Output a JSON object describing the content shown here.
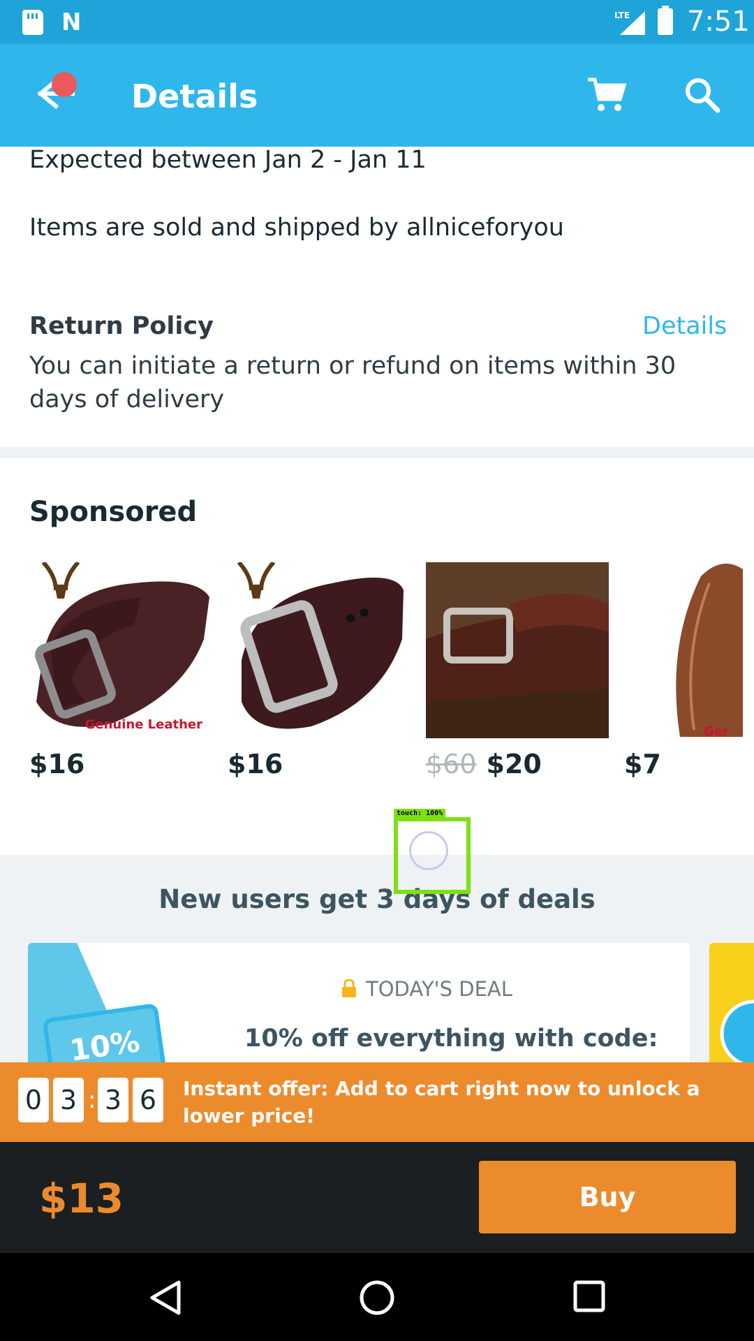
{
  "status_bar": {
    "time": "7:51",
    "network": "LTE"
  },
  "app_bar": {
    "title": "Details",
    "icons": [
      "back-arrow-icon",
      "cart-icon",
      "search-icon"
    ]
  },
  "shipping": {
    "expected": "Expected between Jan 2 - Jan 11",
    "sold_by": "Items are sold and shipped by allniceforyou"
  },
  "return_policy": {
    "title": "Return Policy",
    "details_link": "Details",
    "text": "You can initiate a return or refund on items within 30 days of delivery"
  },
  "sponsored": {
    "title": "Sponsored",
    "items": [
      {
        "price": "$16",
        "original_price": "",
        "image_text": "Genuine Leather"
      },
      {
        "price": "$16",
        "original_price": ""
      },
      {
        "price": "$20",
        "original_price": "$60"
      },
      {
        "price": "$7",
        "original_price": "",
        "image_text": "Ger"
      }
    ]
  },
  "touch_indicator": {
    "label": "touch: 100%"
  },
  "deals": {
    "title": "New users get 3 days of deals",
    "card": {
      "label": "TODAY'S DEAL",
      "headline": "10% off everything with code:",
      "ticket_text": "10%"
    }
  },
  "offer": {
    "countdown": [
      "0",
      "3",
      "3",
      "6"
    ],
    "separator": ":",
    "text": "Instant offer: Add to cart right now to unlock a lower price!"
  },
  "buy_bar": {
    "price": "$13",
    "button_label": "Buy"
  },
  "colors": {
    "primary": "#2fb7ec",
    "status_bar": "#1ea4d9",
    "accent": "#ec8b2c",
    "dark": "#1b1f22"
  }
}
